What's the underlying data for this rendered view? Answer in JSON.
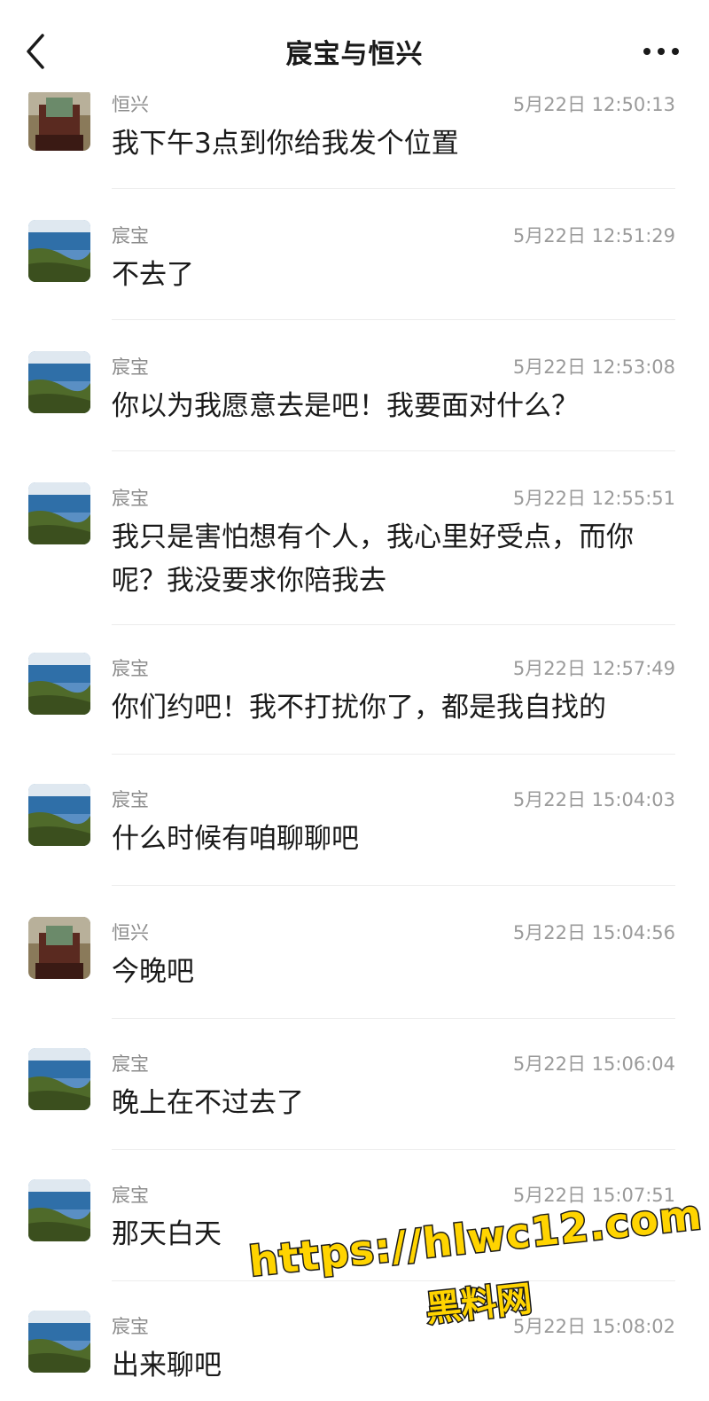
{
  "header": {
    "title": "宸宝与恒兴",
    "back_icon": "chevron-left-icon",
    "more_icon": "more-dots-icon"
  },
  "messages": [
    {
      "sender": "恒兴",
      "time": "5月22日 12:50:13",
      "text": "我下午3点到你给我发个位置",
      "avatar": "portrait-avatar"
    },
    {
      "sender": "宸宝",
      "time": "5月22日 12:51:29",
      "text": "不去了",
      "avatar": "seaside-avatar"
    },
    {
      "sender": "宸宝",
      "time": "5月22日 12:53:08",
      "text": "你以为我愿意去是吧！我要面对什么？",
      "avatar": "seaside-avatar"
    },
    {
      "sender": "宸宝",
      "time": "5月22日 12:55:51",
      "text": "我只是害怕想有个人，我心里好受点，而你呢？我没要求你陪我去",
      "avatar": "seaside-avatar"
    },
    {
      "sender": "宸宝",
      "time": "5月22日 12:57:49",
      "text": "你们约吧！我不打扰你了，都是我自找的",
      "avatar": "seaside-avatar"
    },
    {
      "sender": "宸宝",
      "time": "5月22日 15:04:03",
      "text": "什么时候有咱聊聊吧",
      "avatar": "seaside-avatar"
    },
    {
      "sender": "恒兴",
      "time": "5月22日 15:04:56",
      "text": "今晚吧",
      "avatar": "portrait-avatar"
    },
    {
      "sender": "宸宝",
      "time": "5月22日 15:06:04",
      "text": "晚上在不过去了",
      "avatar": "seaside-avatar"
    },
    {
      "sender": "宸宝",
      "time": "5月22日 15:07:51",
      "text": "那天白天",
      "avatar": "seaside-avatar"
    },
    {
      "sender": "宸宝",
      "time": "5月22日 15:08:02",
      "text": "出来聊吧",
      "avatar": "seaside-avatar"
    }
  ],
  "watermark": {
    "url": "https://hlwc12.com",
    "name": "黑料网"
  },
  "colors": {
    "background": "#ffffff",
    "meta_text": "#8c8c8c",
    "divider": "#ececec",
    "watermark_fill": "#ffd400"
  }
}
